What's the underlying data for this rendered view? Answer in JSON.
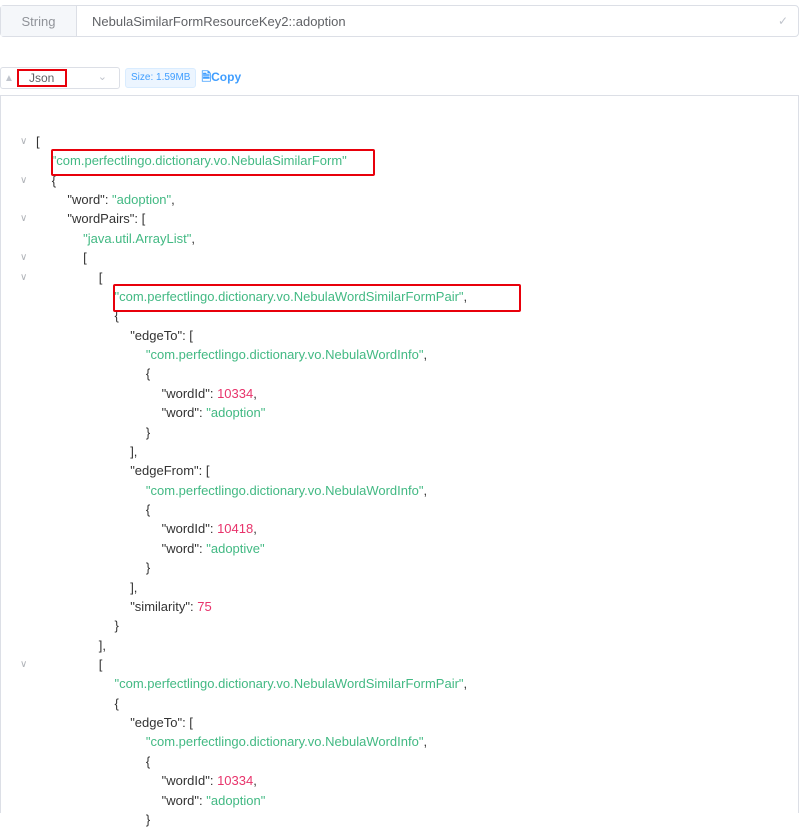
{
  "key": {
    "type": "String",
    "name": "NebulaSimilarFormResourceKey2::adoption"
  },
  "toolbar": {
    "format": "Json",
    "size": "Size: 1.59MB",
    "copy": "Copy"
  },
  "lines": [
    {
      "i": 0,
      "f": 1,
      "t": [
        [
          "p",
          "["
        ]
      ]
    },
    {
      "i": 1,
      "t": [
        [
          "s",
          "\"com.perfectlingo.dictionary.vo.NebulaSimilarForm\""
        ]
      ]
    },
    {
      "i": 1,
      "f": 1,
      "t": [
        [
          "p",
          "{"
        ]
      ]
    },
    {
      "i": 2,
      "t": [
        [
          "k",
          "\"word\""
        ],
        [
          "p",
          ": "
        ],
        [
          "s",
          "\"adoption\""
        ],
        [
          "p",
          ","
        ]
      ]
    },
    {
      "i": 2,
      "f": 1,
      "t": [
        [
          "k",
          "\"wordPairs\""
        ],
        [
          "p",
          ": ["
        ]
      ]
    },
    {
      "i": 3,
      "t": [
        [
          "s",
          "\"java.util.ArrayList\""
        ],
        [
          "p",
          ","
        ]
      ]
    },
    {
      "i": 3,
      "f": 1,
      "t": [
        [
          "p",
          "["
        ]
      ]
    },
    {
      "i": 4,
      "f": 1,
      "t": [
        [
          "p",
          "["
        ]
      ]
    },
    {
      "i": 5,
      "t": [
        [
          "s",
          "\"com.perfectlingo.dictionary.vo.NebulaWordSimilarFormPair\""
        ],
        [
          "p",
          ","
        ]
      ]
    },
    {
      "i": 5,
      "t": [
        [
          "p",
          "{"
        ]
      ]
    },
    {
      "i": 6,
      "t": [
        [
          "k",
          "\"edgeTo\""
        ],
        [
          "p",
          ": ["
        ]
      ]
    },
    {
      "i": 7,
      "t": [
        [
          "s",
          "\"com.perfectlingo.dictionary.vo.NebulaWordInfo\""
        ],
        [
          "p",
          ","
        ]
      ]
    },
    {
      "i": 7,
      "t": [
        [
          "p",
          "{"
        ]
      ]
    },
    {
      "i": 8,
      "t": [
        [
          "k",
          "\"wordId\""
        ],
        [
          "p",
          ": "
        ],
        [
          "n",
          "10334"
        ],
        [
          "p",
          ","
        ]
      ]
    },
    {
      "i": 8,
      "t": [
        [
          "k",
          "\"word\""
        ],
        [
          "p",
          ": "
        ],
        [
          "s",
          "\"adoption\""
        ]
      ]
    },
    {
      "i": 7,
      "t": [
        [
          "p",
          "}"
        ]
      ]
    },
    {
      "i": 6,
      "t": [
        [
          "p",
          "],"
        ]
      ]
    },
    {
      "i": 6,
      "t": [
        [
          "k",
          "\"edgeFrom\""
        ],
        [
          "p",
          ": ["
        ]
      ]
    },
    {
      "i": 7,
      "t": [
        [
          "s",
          "\"com.perfectlingo.dictionary.vo.NebulaWordInfo\""
        ],
        [
          "p",
          ","
        ]
      ]
    },
    {
      "i": 7,
      "t": [
        [
          "p",
          "{"
        ]
      ]
    },
    {
      "i": 8,
      "t": [
        [
          "k",
          "\"wordId\""
        ],
        [
          "p",
          ": "
        ],
        [
          "n",
          "10418"
        ],
        [
          "p",
          ","
        ]
      ]
    },
    {
      "i": 8,
      "t": [
        [
          "k",
          "\"word\""
        ],
        [
          "p",
          ": "
        ],
        [
          "s",
          "\"adoptive\""
        ]
      ]
    },
    {
      "i": 7,
      "t": [
        [
          "p",
          "}"
        ]
      ]
    },
    {
      "i": 6,
      "t": [
        [
          "p",
          "],"
        ]
      ]
    },
    {
      "i": 6,
      "t": [
        [
          "k",
          "\"similarity\""
        ],
        [
          "p",
          ": "
        ],
        [
          "n",
          "75"
        ]
      ]
    },
    {
      "i": 5,
      "t": [
        [
          "p",
          "}"
        ]
      ]
    },
    {
      "i": 4,
      "t": [
        [
          "p",
          "],"
        ]
      ]
    },
    {
      "i": 4,
      "f": 1,
      "t": [
        [
          "p",
          "["
        ]
      ]
    },
    {
      "i": 5,
      "t": [
        [
          "s",
          "\"com.perfectlingo.dictionary.vo.NebulaWordSimilarFormPair\""
        ],
        [
          "p",
          ","
        ]
      ]
    },
    {
      "i": 5,
      "t": [
        [
          "p",
          "{"
        ]
      ]
    },
    {
      "i": 6,
      "t": [
        [
          "k",
          "\"edgeTo\""
        ],
        [
          "p",
          ": ["
        ]
      ]
    },
    {
      "i": 7,
      "t": [
        [
          "s",
          "\"com.perfectlingo.dictionary.vo.NebulaWordInfo\""
        ],
        [
          "p",
          ","
        ]
      ]
    },
    {
      "i": 7,
      "t": [
        [
          "p",
          "{"
        ]
      ]
    },
    {
      "i": 8,
      "t": [
        [
          "k",
          "\"wordId\""
        ],
        [
          "p",
          ": "
        ],
        [
          "n",
          "10334"
        ],
        [
          "p",
          ","
        ]
      ]
    },
    {
      "i": 8,
      "t": [
        [
          "k",
          "\"word\""
        ],
        [
          "p",
          ": "
        ],
        [
          "s",
          "\"adoption\""
        ]
      ]
    },
    {
      "i": 7,
      "t": [
        [
          "p",
          "}"
        ]
      ]
    }
  ]
}
